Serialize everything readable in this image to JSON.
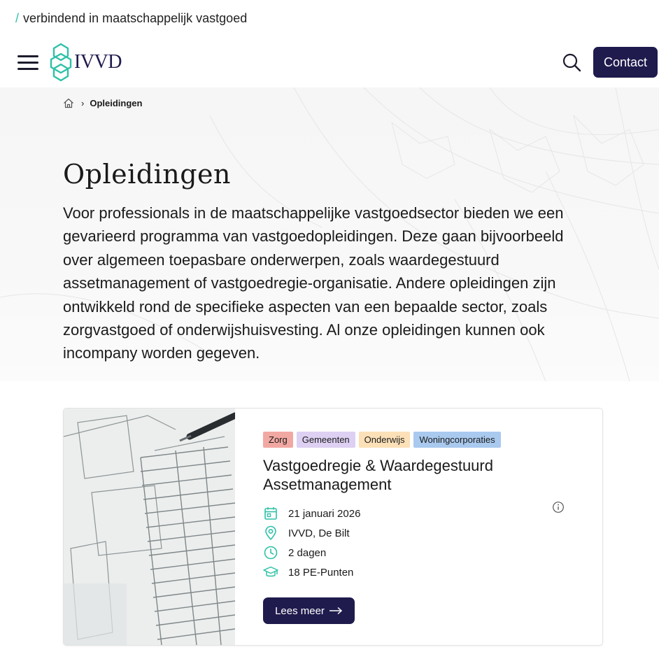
{
  "tagline": "verbindend in maatschappelijk vastgoed",
  "header": {
    "logo_text": "IVVD",
    "contact_label": "Contact"
  },
  "breadcrumb": {
    "current": "Opleidingen"
  },
  "page": {
    "title": "Opleidingen",
    "intro": "Voor professionals in de maatschappelijke vastgoedsector bieden we een gevarieerd programma van vastgoedopleidingen. Deze gaan bijvoorbeeld over algemeen toepasbare onderwerpen, zoals waardegestuurd assetmanagement of vastgoedregie-organisatie. Andere opleidingen zijn ontwikkeld rond de specifieke aspecten van een bepaalde sector, zoals zorgvastgoed of onderwijshuisvesting. Al onze opleidingen kunnen ook incompany worden gegeven."
  },
  "card": {
    "tags": [
      {
        "label": "Zorg",
        "color": "#f2a8a2"
      },
      {
        "label": "Gemeenten",
        "color": "#ddd0f2"
      },
      {
        "label": "Onderwijs",
        "color": "#fbe0b8"
      },
      {
        "label": "Woningcorporaties",
        "color": "#a9c9ee"
      }
    ],
    "title": "Vastgoedregie & Waardegestuurd Assetmanagement",
    "date": "21 januari 2026",
    "location": "IVVD, De Bilt",
    "duration": "2 dagen",
    "points": "18 PE-Punten",
    "button_label": "Lees meer",
    "icons": [
      "calendar-icon",
      "location-pin-icon",
      "clock-icon",
      "graduation-cap-icon",
      "info-icon"
    ],
    "icon_color": "#2fc1a8"
  },
  "colors": {
    "brand": "#1f1b4d",
    "accent": "#2fc1a8"
  }
}
